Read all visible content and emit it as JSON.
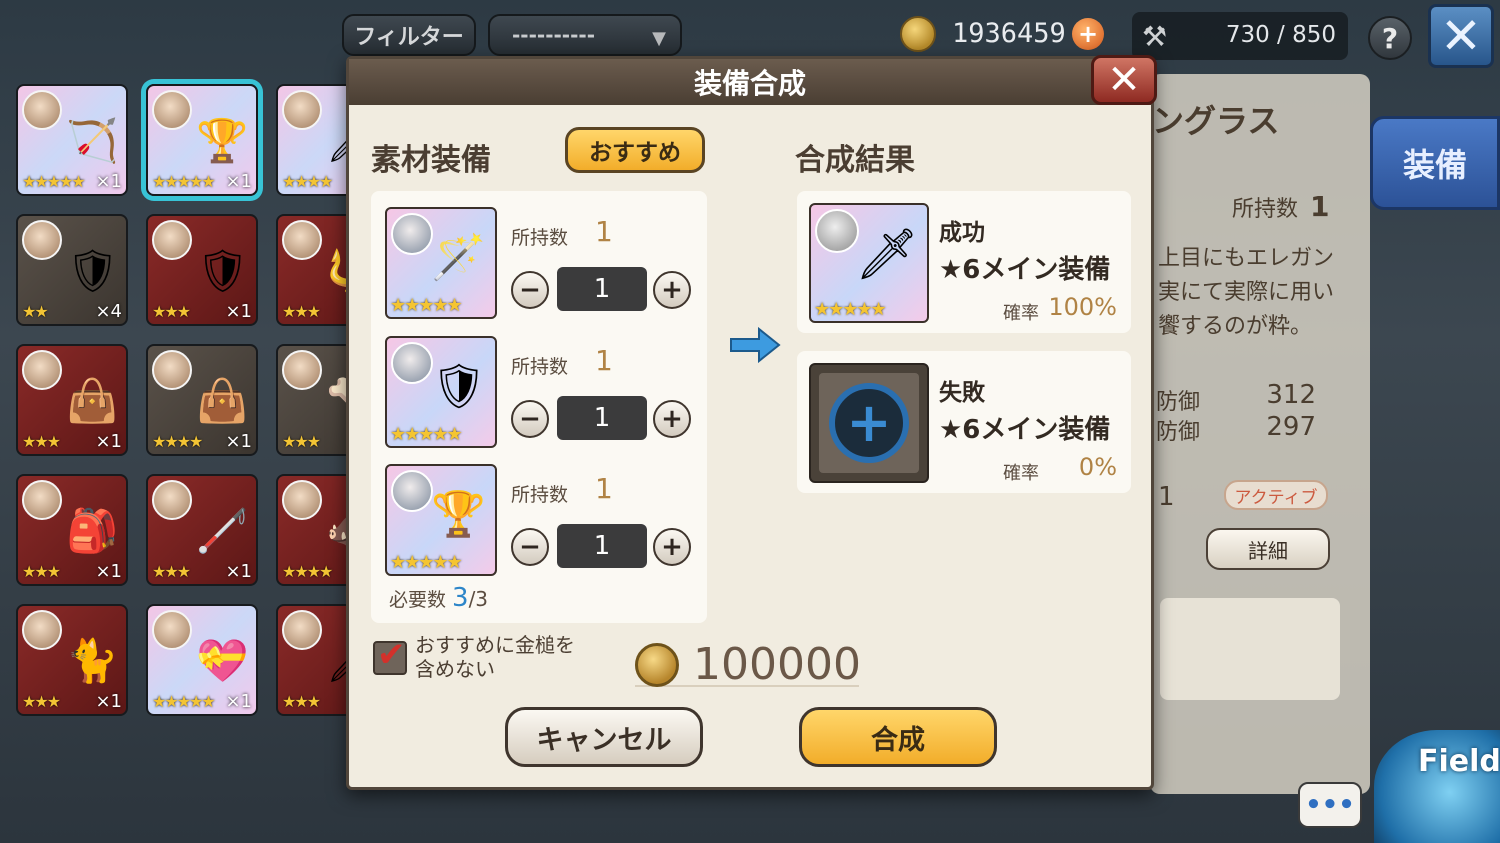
{
  "topbar": {
    "filter_label": "フィルター",
    "filter_value": "----------",
    "coins": "1936459",
    "capacity": "730 / 850",
    "help_label": "?",
    "close_label": "✕"
  },
  "inventory": {
    "slots": [
      {
        "style": "pastel",
        "stars": "★★★★★",
        "count": "×1",
        "item": "🏹"
      },
      {
        "style": "pastel",
        "stars": "★★★★★",
        "count": "×1",
        "item": "🏆"
      },
      {
        "style": "pastel",
        "stars": "★★★★",
        "count": "",
        "item": "🗡"
      },
      {
        "style": "dark",
        "stars": "★★",
        "count": "×4",
        "item": "🛡"
      },
      {
        "style": "red",
        "stars": "★★★",
        "count": "×1",
        "item": "🛡"
      },
      {
        "style": "red",
        "stars": "★★★",
        "count": "",
        "item": "🔱"
      },
      {
        "style": "red",
        "stars": "★★★",
        "count": "×1",
        "item": "👜"
      },
      {
        "style": "dark",
        "stars": "★★★★",
        "count": "×1",
        "item": "👜"
      },
      {
        "style": "dark",
        "stars": "★★★",
        "count": "",
        "item": "🦴"
      },
      {
        "style": "red",
        "stars": "★★★",
        "count": "×1",
        "item": "🎒"
      },
      {
        "style": "red",
        "stars": "★★★",
        "count": "×1",
        "item": "🦯"
      },
      {
        "style": "red",
        "stars": "★★★★",
        "count": "",
        "item": "🐗"
      },
      {
        "style": "red",
        "stars": "★★★",
        "count": "×1",
        "item": "🐈"
      },
      {
        "style": "pastel",
        "stars": "★★★★★",
        "count": "×1",
        "item": "💝"
      },
      {
        "style": "red",
        "stars": "★★★",
        "count": "",
        "item": "🗡"
      }
    ]
  },
  "detail": {
    "title": "ングラス",
    "own_label": "所持数",
    "own_value": "1",
    "desc": "上目にもエレガン実にて実際に用い饗するのが粋。",
    "stat1_label": "防御",
    "stat1_value": "312",
    "stat2_label": "防御",
    "stat2_value": "297",
    "level": "1",
    "active_label": "アクティブ",
    "detail_button": "詳細",
    "equip_tab": "装備"
  },
  "dialog": {
    "title": "装備合成",
    "close_label": "✕",
    "materials_title": "素材装備",
    "recommend_label": "おすすめ",
    "result_title": "合成結果",
    "own_label": "所持数",
    "materials": [
      {
        "item": "🪄",
        "stars": "★★★★★",
        "own": "1",
        "qty": "1"
      },
      {
        "item": "🛡",
        "stars": "★★★★★",
        "own": "1",
        "qty": "1"
      },
      {
        "item": "🏆",
        "stars": "★★★★★",
        "own": "1",
        "qty": "1"
      }
    ],
    "required_label": "必要数",
    "required_current": "3",
    "required_total": "/3",
    "results": [
      {
        "status": "成功",
        "name": "★6メイン装備",
        "rate_label": "確率",
        "rate": "100%",
        "item": "🗡",
        "stars": "★★★★★"
      },
      {
        "status": "失敗",
        "name": "★6メイン装備",
        "rate_label": "確率",
        "rate": "0%",
        "item": "+",
        "stars": ""
      }
    ],
    "checkbox_label": "おすすめに金槌を含めない",
    "cost": "100000",
    "cancel_label": "キャンセル",
    "synth_label": "合成"
  },
  "bottom": {
    "chat_label": "•••",
    "field_label": "Field"
  },
  "colors": {
    "accent_gold": "#f2ad2a",
    "close_red": "#8e2a22",
    "selected_cyan": "#38c3d6",
    "count_blue": "#2d86c9"
  }
}
